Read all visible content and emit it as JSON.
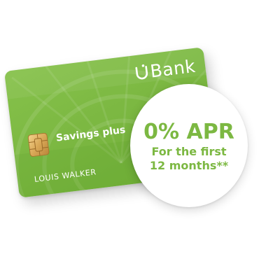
{
  "card": {
    "brand": "Bank",
    "product": "Savings plus",
    "cardholder": "LOUIS WALKER",
    "color": "#7cb842"
  },
  "offer": {
    "headline": "0% APR",
    "subtext": "For the first 12 months**",
    "color": "#7cb842",
    "background": "#ffffff"
  },
  "icons": [
    "bank-logo-icon",
    "chip-icon"
  ]
}
